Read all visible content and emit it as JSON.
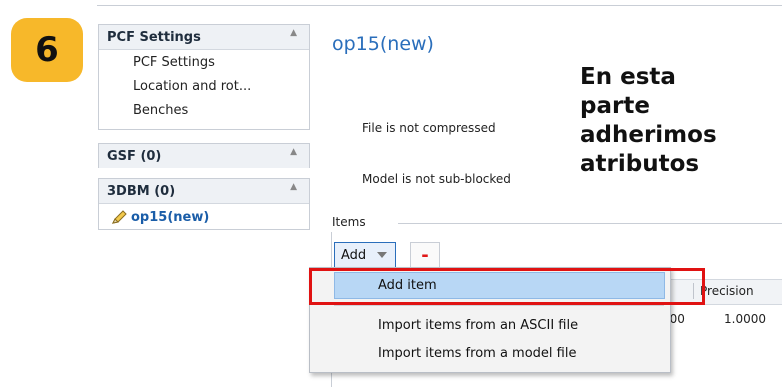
{
  "step_badge": "6",
  "sidebar": {
    "pcf": {
      "header": "PCF Settings",
      "items": [
        "PCF Settings",
        "Location and rot...",
        "Benches"
      ]
    },
    "gsf": {
      "header": "GSF (0)"
    },
    "dbm": {
      "header": "3DBM (0)",
      "model": "op15(new)"
    }
  },
  "main": {
    "title": "op15(new)",
    "compress_status": "File is not compressed",
    "subblock_status": "Model is not sub-blocked",
    "items_label": "Items",
    "add_button": "Add",
    "remove_button": "-"
  },
  "annotation": [
    "En esta",
    "parte",
    "adherimos",
    "atributos"
  ],
  "grid": {
    "precision_header": "Precision",
    "cells": [
      "000",
      "1.0000"
    ]
  },
  "menu": {
    "add_item": "Add item",
    "import_ascii": "Import items from an ASCII file",
    "import_model": "Import items from a model file"
  },
  "colors": {
    "badge": "#f7b82a",
    "accent": "#2a6ebb",
    "highlight": "#e01212",
    "selected": "#b8d7f5"
  },
  "icons": {
    "model": "pencil-icon",
    "collapse": "chevron-up-icon",
    "dropdown": "chevron-down-icon"
  }
}
